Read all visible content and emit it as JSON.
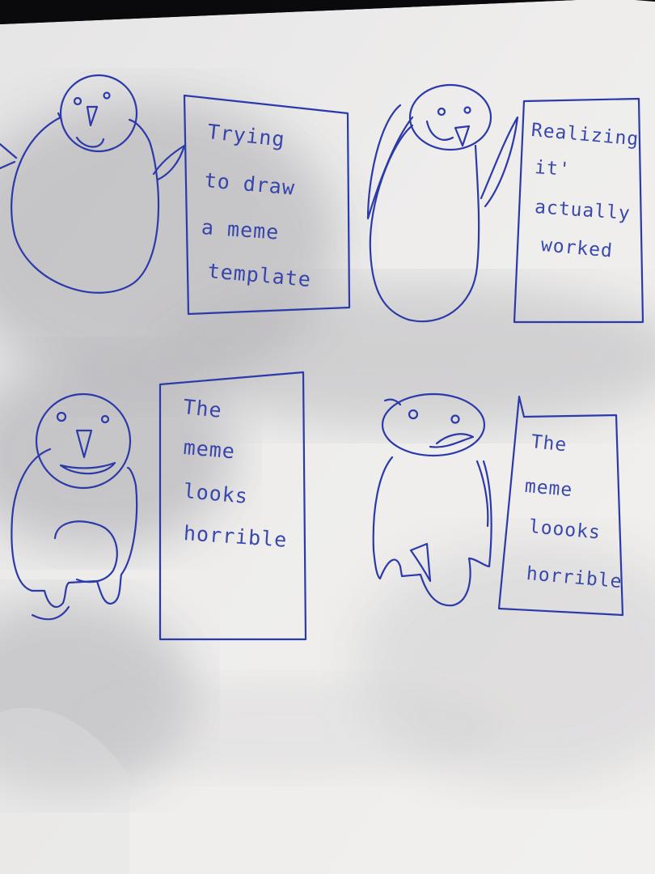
{
  "panels": [
    {
      "id": "top-left",
      "caption_lines": [
        "Trying",
        "to draw",
        "a  meme",
        "template"
      ]
    },
    {
      "id": "top-right",
      "caption_lines": [
        "Realizing",
        "it'",
        "actually",
        "worked"
      ]
    },
    {
      "id": "bottom-left",
      "caption_lines": [
        "The",
        "meme",
        "looks",
        "horrible"
      ]
    },
    {
      "id": "bottom-right",
      "caption_lines": [
        "The",
        "meme",
        "loooks",
        "horrible"
      ]
    }
  ],
  "colors": {
    "ink": "#2b3aa8",
    "paper_light": "#ecebea",
    "paper_shadow": "#bdbcc0",
    "background": "#0a0a0c"
  }
}
